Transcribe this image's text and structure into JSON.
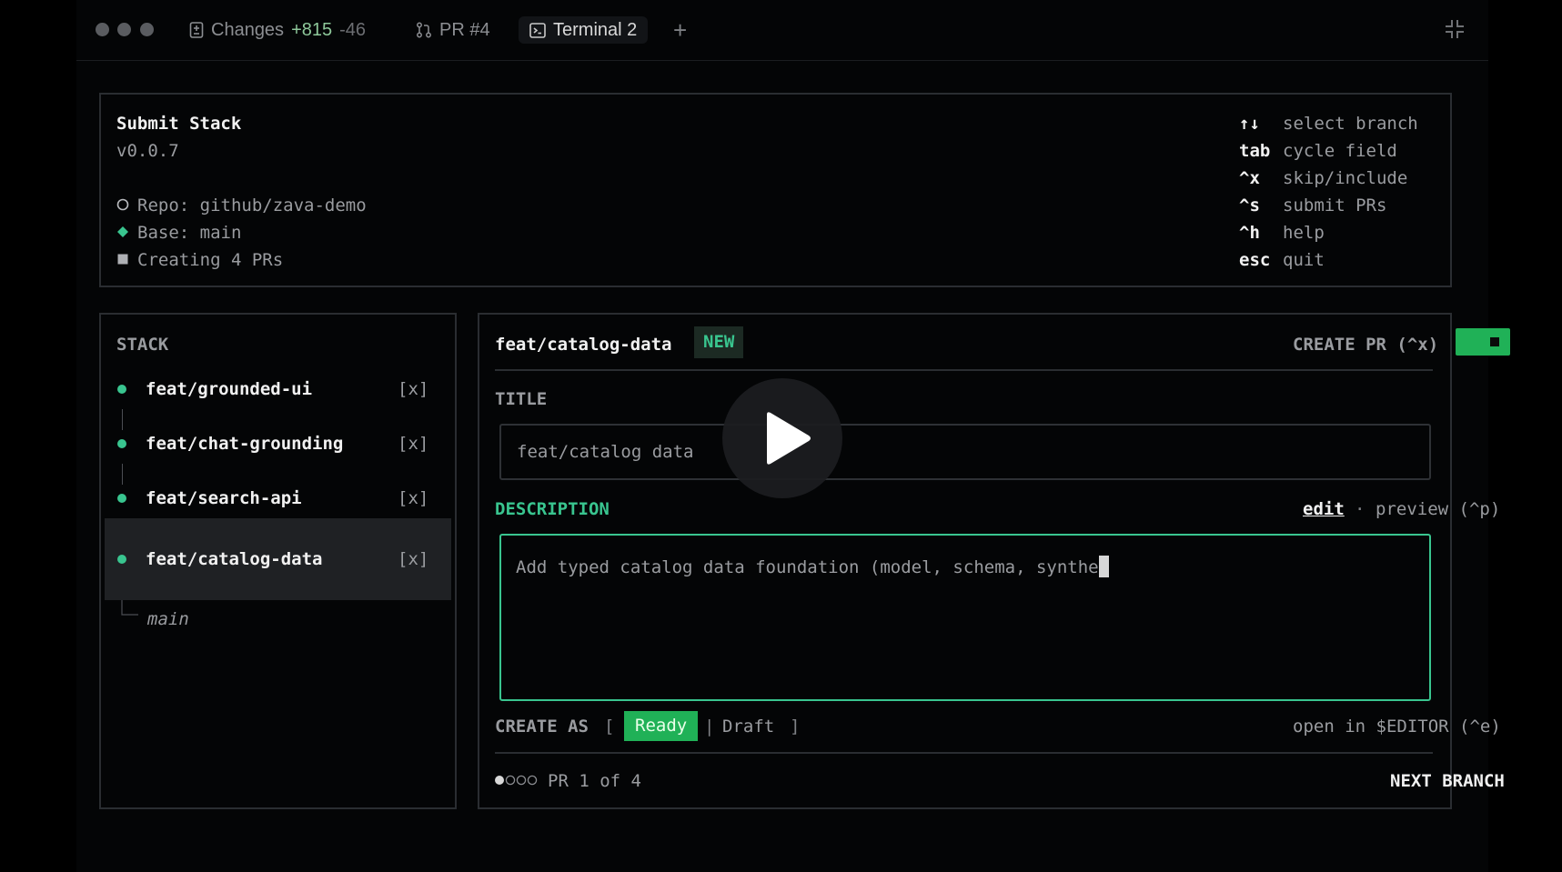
{
  "tabs": {
    "changes": {
      "label": "Changes",
      "added": "+815",
      "removed": "-46"
    },
    "pr": {
      "label": "PR #4"
    },
    "terminal": {
      "label": "Terminal 2"
    },
    "add": "+"
  },
  "header": {
    "title": "Submit Stack",
    "version": "v0.0.7",
    "repo": "Repo: github/zava-demo",
    "base": "Base: main",
    "creating": "Creating 4 PRs",
    "shortcuts": [
      {
        "key": "↑↓",
        "desc": "select branch"
      },
      {
        "key": "tab",
        "desc": "cycle field"
      },
      {
        "key": "^x",
        "desc": "skip/include"
      },
      {
        "key": "^s",
        "desc": "submit PRs"
      },
      {
        "key": "^h",
        "desc": "help"
      },
      {
        "key": "esc",
        "desc": "quit"
      }
    ]
  },
  "stack": {
    "title": "STACK",
    "items": [
      {
        "name": "feat/grounded-ui",
        "mark": "[x]"
      },
      {
        "name": "feat/chat-grounding",
        "mark": "[x]"
      },
      {
        "name": "feat/search-api",
        "mark": "[x]"
      },
      {
        "name": "feat/catalog-data",
        "mark": "[x]"
      }
    ],
    "base": "main"
  },
  "detail": {
    "branch": "feat/catalog-data",
    "badge": "NEW",
    "create_pr_label": "CREATE PR (^x)",
    "title_label": "TITLE",
    "title_value": "feat/catalog data",
    "description_label": "DESCRIPTION",
    "edit_label": "edit",
    "separator": "·",
    "preview_label": "preview (^p)",
    "description_value": "Add typed catalog data foundation (model, schema, synthe",
    "create_as_label": "CREATE AS",
    "bracket_open": "[",
    "ready_label": "Ready",
    "bracket_mid": "|",
    "draft_label": "Draft",
    "bracket_close": "]",
    "open_editor_label": "open in $EDITOR (^e)",
    "pr_progress": "PR 1 of 4",
    "next_branch_label": "NEXT BRANCH"
  },
  "colors": {
    "accent": "#39c58f",
    "ready": "#20b157",
    "background": "#000000"
  }
}
